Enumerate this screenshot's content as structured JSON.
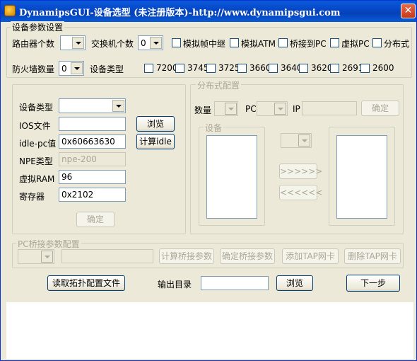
{
  "window": {
    "title": "DynamipsGUI-设备选型 (未注册版本)-http://www.dynamipsgui.com"
  },
  "device_params": {
    "legend": "设备参数设置",
    "router_count_label": "路由器个数",
    "router_count_value": "",
    "switch_count_label": "交换机个数",
    "switch_count_value": "0",
    "frame_relay": "模拟帧中继",
    "atm": "模拟ATM",
    "bridge_pc": "桥接到PC",
    "virtual_pc": "虚拟PC",
    "distributed": "分布式",
    "firewall_count_label": "防火墙数量",
    "firewall_count_value": "0",
    "device_type_label": "设备类型",
    "models": [
      "7200",
      "3745",
      "3725",
      "3660",
      "3640",
      "3620",
      "2691",
      "2600"
    ]
  },
  "left_panel": {
    "device_type_label": "设备类型",
    "device_type_value": "",
    "ios_label": "IOS文件",
    "ios_value": "",
    "browse": "浏览",
    "idlepc_label": "idle-pc值",
    "idlepc_value": "0x60663630",
    "calc_idle": "计算idle",
    "npe_label": "NPE类型",
    "npe_value": "npe-200",
    "ram_label": "虚拟RAM",
    "ram_value": "96",
    "reg_label": "寄存器",
    "reg_value": "0x2102",
    "confirm": "确定"
  },
  "distributed_panel": {
    "legend": "分布式配置",
    "count_label": "数量",
    "pc_label": "PC",
    "ip_label": "IP",
    "confirm": "确定",
    "devices_legend": "设备",
    "move_right": ">>>>>>",
    "move_left": "<<<<<<"
  },
  "pc_bridge": {
    "legend": "PC桥接参数配置",
    "calc": "计算桥接参数",
    "confirm": "确定桥接参数",
    "add_tap": "添加TAP网卡",
    "remove_tap": "删除TAP网卡"
  },
  "bottom": {
    "read_topology": "读取拓扑配置文件",
    "output_dir_label": "输出目录",
    "output_dir_value": "",
    "browse": "浏览",
    "next": "下一步"
  }
}
